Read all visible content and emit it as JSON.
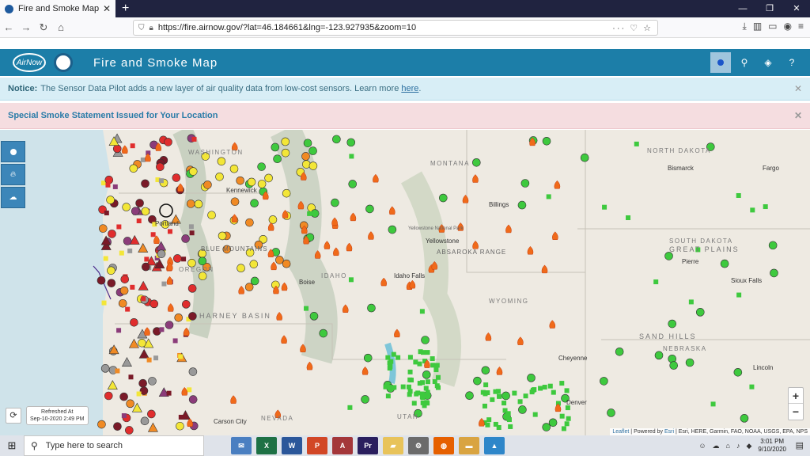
{
  "browser": {
    "tab_title": "Fire and Smoke Map",
    "url": "https://fire.airnow.gov/?lat=46.184661&lng=-123.927935&zoom=10"
  },
  "app": {
    "logo_text": "AirNow",
    "title": "Fire and Smoke Map"
  },
  "notice": {
    "label": "Notice:",
    "text": "The Sensor Data Pilot adds a new layer of air quality data from low-cost sensors. Learn more",
    "link": "here",
    "suffix": "."
  },
  "smoke_statement": "Special Smoke Statement Issued for Your Location",
  "map": {
    "state_labels": [
      "WASHINGTON",
      "MONTANA",
      "NORTH DAKOTA",
      "SOUTH DAKOTA",
      "OREGON",
      "IDAHO",
      "WYOMING",
      "NEBRASKA",
      "NEVADA",
      "UTAH"
    ],
    "city_labels": [
      "Portland",
      "Kennewick",
      "Billings",
      "Bismarck",
      "Fargo",
      "Pierre",
      "Sioux Falls",
      "Boise",
      "Idaho Falls",
      "Cheyenne",
      "Denver",
      "Lincoln",
      "Carson City",
      "Yellowstone"
    ],
    "region_labels": [
      "GREAT PLAINS",
      "HARNEY BASIN",
      "SAND HILLS",
      "BLUE MOUNTAINS",
      "ABSAROKA RANGE",
      "Yellowstone National Park"
    ],
    "refresh_label": "Refreshed At",
    "refresh_time": "Sep-10-2020 2:49 PM",
    "attribution_link1": "Leaflet",
    "attribution_text": " | Powered by ",
    "attribution_link2": "Esri",
    "attribution_rest": " | Esri, HERE, Garmin, FAO, NOAA, USGS, EPA, NPS",
    "zoom_in": "+",
    "zoom_out": "−"
  },
  "taskbar": {
    "search_placeholder": "Type here to search",
    "time": "3:01 PM",
    "date": "9/10/2020"
  },
  "colors": {
    "header": "#1c7ea8",
    "good": "#3ec93e",
    "moderate": "#f3e637",
    "usg": "#f08a24",
    "unhealthy": "#e02d2d",
    "very_unhealthy": "#8b3c7a",
    "hazardous": "#7a1a28"
  }
}
